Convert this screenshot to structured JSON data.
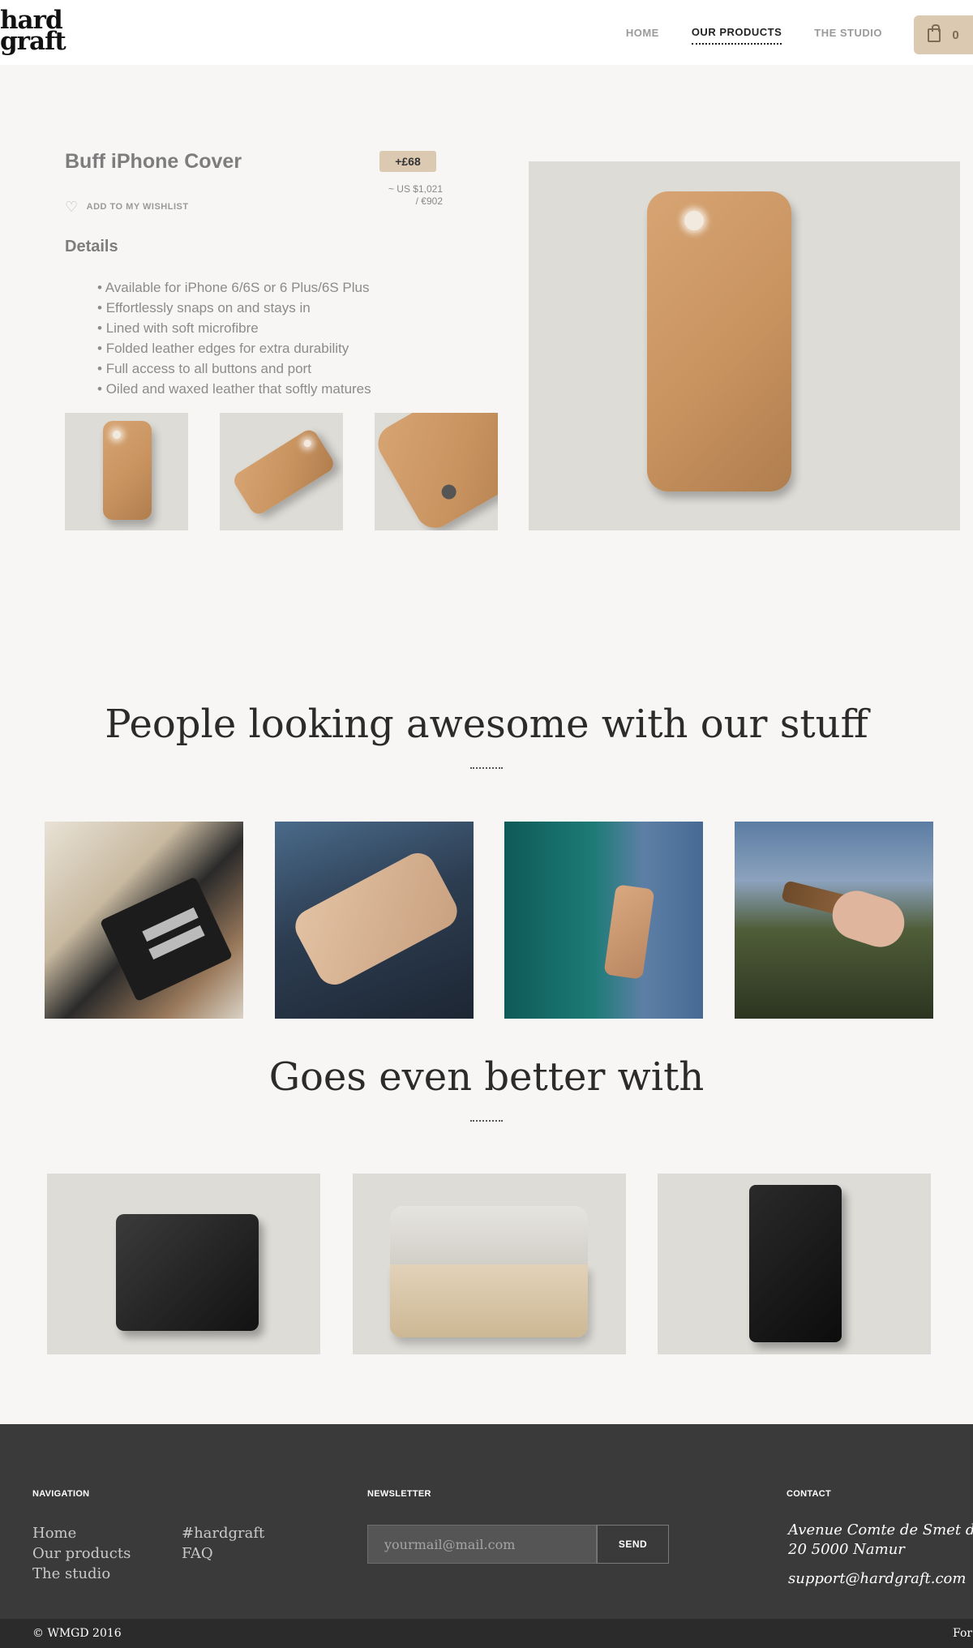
{
  "header": {
    "logo_line1": "hard",
    "logo_line2": "graft",
    "nav": [
      "HOME",
      "OUR PRODUCTS",
      "THE STUDIO"
    ],
    "cart_count": "0"
  },
  "product": {
    "title": "Buff iPhone Cover",
    "price": "+£68",
    "price_usd": "~ US $1,021",
    "price_eur": "/ €902",
    "wishlist": "ADD TO MY WISHLIST",
    "details_title": "Details",
    "details": [
      "Available for iPhone 6/6S or 6 Plus/6S Plus",
      "Effortlessly snaps on and stays in",
      "Lined with soft microfibre",
      "Folded leather edges for extra durability",
      "Full access to all buttons and port",
      "Oiled and waxed leather that softly matures"
    ]
  },
  "sections": {
    "social_title": "People looking awesome with our stuff",
    "related_title": "Goes even better with"
  },
  "footer": {
    "nav_label": "NAVIGATION",
    "nav_links": [
      "Home",
      "Our products",
      "The studio",
      "#hardgraft",
      "FAQ"
    ],
    "newsletter_label": "NEWSLETTER",
    "newsletter_placeholder": "yourmail@mail.com",
    "newsletter_button": "SEND",
    "contact_label": "CONTACT",
    "contact_address1": "Avenue Comte de Smet de Na",
    "contact_address2": "20 5000 Namur",
    "contact_email": "support@hardgraft.com",
    "copyright": "© WMGD 2016",
    "bottom_right": "For"
  },
  "colors": {
    "accent_tan": "#dcc9b2",
    "footer_bg": "#3a3a3a",
    "page_bg": "#f7f6f4"
  }
}
